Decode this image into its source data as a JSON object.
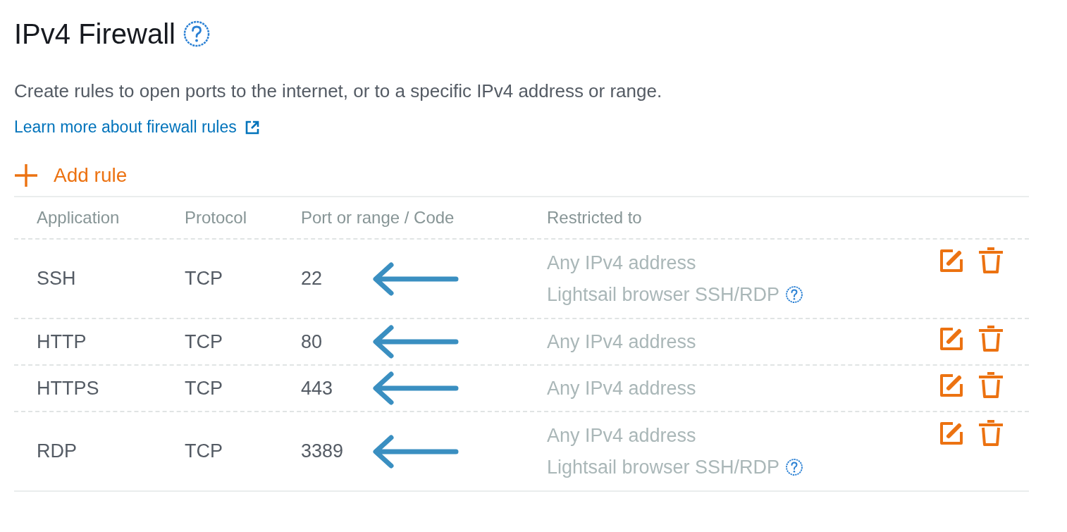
{
  "title": "IPv4 Firewall",
  "description": "Create rules to open ports to the internet, or to a specific IPv4 address or range.",
  "learn_link": "Learn more about firewall rules",
  "add_rule": "Add rule",
  "table": {
    "columns": [
      "Application",
      "Protocol",
      "Port or range / Code",
      "Restricted to"
    ],
    "rows": [
      {
        "application": "SSH",
        "protocol": "TCP",
        "port": "22",
        "arrow": true,
        "restricted": [
          {
            "text": "Any IPv4 address",
            "help": false
          },
          {
            "text": "Lightsail browser SSH/RDP",
            "help": true
          }
        ]
      },
      {
        "application": "HTTP",
        "protocol": "TCP",
        "port": "80",
        "arrow": true,
        "restricted": [
          {
            "text": "Any IPv4 address",
            "help": false
          }
        ]
      },
      {
        "application": "HTTPS",
        "protocol": "TCP",
        "port": "443",
        "arrow": true,
        "restricted": [
          {
            "text": "Any IPv4 address",
            "help": false
          }
        ]
      },
      {
        "application": "RDP",
        "protocol": "TCP",
        "port": "3389",
        "arrow": true,
        "restricted": [
          {
            "text": "Any IPv4 address",
            "help": false
          },
          {
            "text": "Lightsail browser SSH/RDP",
            "help": true
          }
        ]
      }
    ]
  }
}
